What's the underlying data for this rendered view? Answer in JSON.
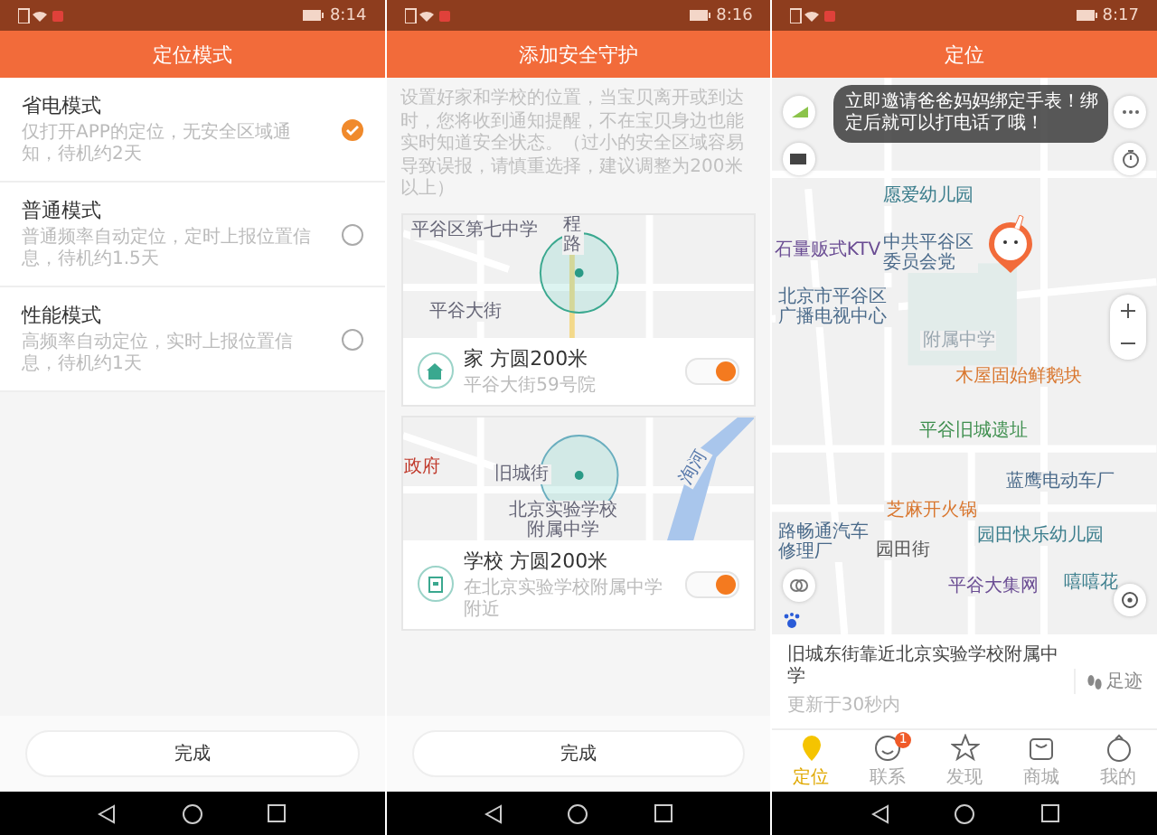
{
  "screens": [
    {
      "kind": "modes",
      "status_time": "8:14",
      "title": "定位模式",
      "modes": [
        {
          "name": "省电模式",
          "desc": "仅打开APP的定位，无安全区域通知，待机约2天",
          "selected": true
        },
        {
          "name": "普通模式",
          "desc": "普通频率自动定位，定时上报位置信息，待机约1.5天",
          "selected": false
        },
        {
          "name": "性能模式",
          "desc": "高频率自动定位，实时上报位置信息，待机约1天",
          "selected": false
        }
      ],
      "done_button": "完成"
    },
    {
      "kind": "zones",
      "status_time": "8:16",
      "title": "添加安全守护",
      "intro": "设置好家和学校的位置，当宝贝离开或到达时，您将收到通知提醒，不在宝贝身边也能实时知道安全状态。（过小的安全区域容易导致误报，请慎重选择，建议调整为200米以上）",
      "zones": [
        {
          "kind": "home",
          "name": "家 方圆200米",
          "address": "平谷大街59号院",
          "on": true,
          "map_labels": [
            "平谷区第七中学",
            "程路",
            "平谷大街"
          ]
        },
        {
          "kind": "school",
          "name": "学校 方圆200米",
          "address": "在北京实验学校附属中学附近",
          "on": true,
          "map_labels": [
            "政府",
            "旧城街",
            "北京实验学校附属中学",
            "洵河"
          ]
        }
      ],
      "done_button": "完成"
    },
    {
      "kind": "map",
      "status_time": "8:17",
      "title": "定位",
      "bubble": "立即邀请爸爸妈妈绑定手表！绑定后就可以打电话了哦！",
      "map_labels": [
        {
          "text": "愿爱幼儿园",
          "color": "#3a7d8c"
        },
        {
          "text": "石量贩式KTV",
          "color": "#6a4c93"
        },
        {
          "text": "中共平谷区委员会党",
          "color": "#4a6a8a"
        },
        {
          "text": "北京市平谷区广播电视中心",
          "color": "#4a6a8a"
        },
        {
          "text": "附属中学",
          "color": "#9aa7b0"
        },
        {
          "text": "木屋固始鲜鹅块",
          "color": "#d9772f"
        },
        {
          "text": "平谷旧城遗址",
          "color": "#3f8f4f"
        },
        {
          "text": "蓝鹰电动车厂",
          "color": "#4a6a8a"
        },
        {
          "text": "芝麻开火锅",
          "color": "#d9772f"
        },
        {
          "text": "路畅通汽车修理厂",
          "color": "#4a6a8a"
        },
        {
          "text": "园田街",
          "color": "#555555"
        },
        {
          "text": "园田快乐幼儿园",
          "color": "#3a7d8c"
        },
        {
          "text": "平谷大集网",
          "color": "#6a4c93"
        },
        {
          "text": "嘻嘻花",
          "color": "#3a7d8c"
        }
      ],
      "address": "旧城东街靠近北京实验学校附属中学",
      "updated": "更新于30秒内",
      "track_button": "足迹",
      "tabs": [
        {
          "label": "定位",
          "selected": true
        },
        {
          "label": "联系",
          "selected": false,
          "badge": "1"
        },
        {
          "label": "发现",
          "selected": false
        },
        {
          "label": "商城",
          "selected": false
        },
        {
          "label": "我的",
          "selected": false
        }
      ]
    }
  ]
}
